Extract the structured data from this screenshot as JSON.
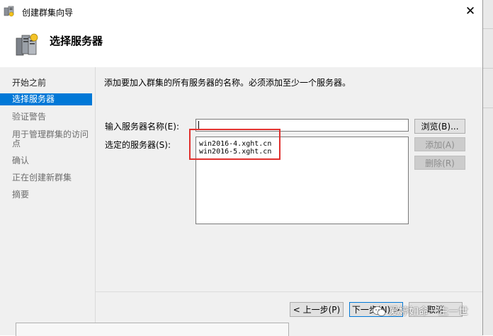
{
  "window": {
    "title": "创建群集向导",
    "close_glyph": "✕"
  },
  "header": {
    "page_title": "选择服务器"
  },
  "sidebar": {
    "steps": [
      {
        "label": "开始之前",
        "state": "done"
      },
      {
        "label": "选择服务器",
        "state": "active"
      },
      {
        "label": "验证警告",
        "state": "pending"
      },
      {
        "label": "用于管理群集的访问",
        "state": "pending"
      },
      {
        "label": "点",
        "state": "pending"
      },
      {
        "label": "确认",
        "state": "pending"
      },
      {
        "label": "正在创建新群集",
        "state": "pending"
      },
      {
        "label": "摘要",
        "state": "pending"
      }
    ]
  },
  "main": {
    "instruction": "添加要加入群集的所有服务器的名称。必须添加至少一个服务器。",
    "server_name_label": "输入服务器名称(E):",
    "server_name_value": "",
    "selected_servers_label": "选定的服务器(S):",
    "selected_servers": [
      "win2016-4.xght.cn",
      "win2016-5.xght.cn"
    ],
    "browse_label": "浏览(B)...",
    "add_label": "添加(A)",
    "remove_label": "删除(R)"
  },
  "footer": {
    "prev_label": "< 上一步(P)",
    "next_label": "下一步(N) >",
    "cancel_label": "取消"
  },
  "watermark": {
    "text": "爱婷如命一生一世"
  },
  "colors": {
    "accent": "#0078d7",
    "panel_bg": "#f0f0f0",
    "highlight_red": "#e0302d"
  },
  "icons": {
    "app": "cluster-wizard-icon",
    "header": "server-cluster-icon",
    "close": "close-icon",
    "watermark": "wechat-icon"
  }
}
